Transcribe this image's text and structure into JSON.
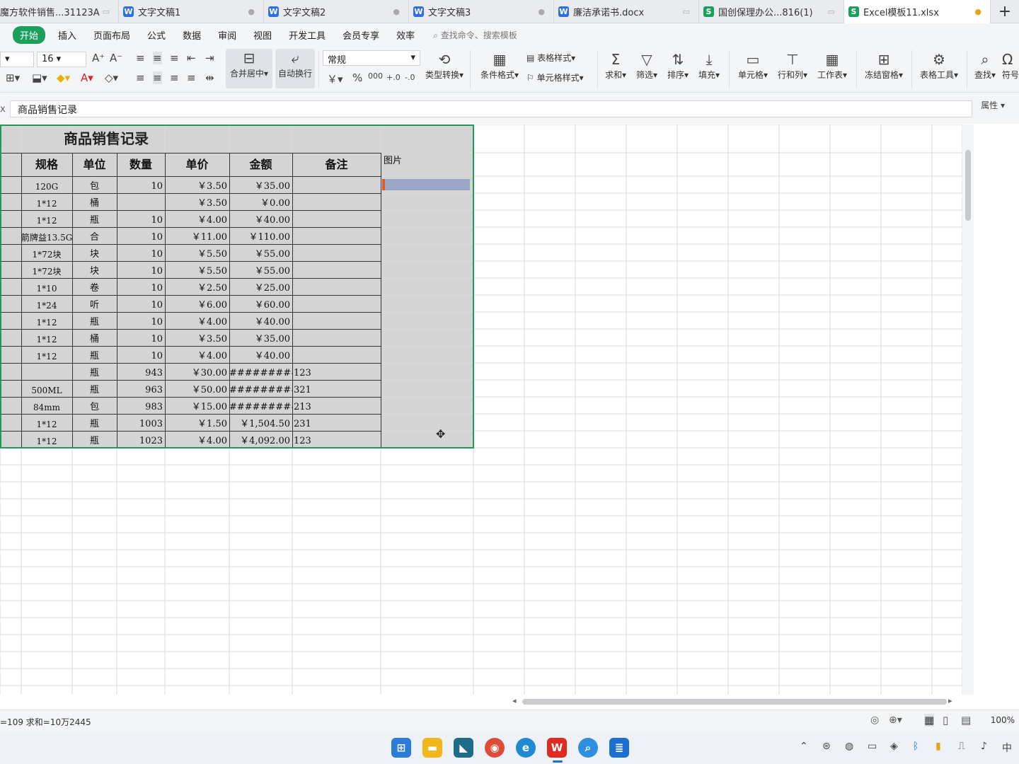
{
  "tabs": [
    {
      "label": "魔方软件销售...31123A",
      "icon": "W"
    },
    {
      "label": "文字文稿1",
      "icon": "W"
    },
    {
      "label": "文字文稿2",
      "icon": "W"
    },
    {
      "label": "文字文稿3",
      "icon": "W"
    },
    {
      "label": "廉洁承诺书.docx",
      "icon": "W"
    },
    {
      "label": "国创保理办公...816(1)",
      "icon": "S"
    },
    {
      "label": "Excel模板11.xlsx",
      "icon": "S"
    }
  ],
  "menu": [
    "开始",
    "插入",
    "页面布局",
    "公式",
    "数据",
    "审阅",
    "视图",
    "开发工具",
    "会员专享",
    "效率"
  ],
  "search_placeholder": "查找命令、搜索模板",
  "ribbon": {
    "font_size": "16",
    "number_format": "常规",
    "merge_label": "合并居中",
    "wrap_label": "自动换行",
    "type_convert": "类型转换",
    "cond_format": "条件格式",
    "table_style": "表格样式",
    "cell_style": "单元格样式",
    "sum": "求和",
    "filter": "筛选",
    "sort": "排序",
    "fill": "填充",
    "cell": "单元格",
    "rowcol": "行和列",
    "worksheet": "工作表",
    "freeze": "冻结窗格",
    "table_tools": "表格工具",
    "find": "查找",
    "symbol": "符号"
  },
  "formula_bar": {
    "value": "商品销售记录",
    "properties": "属性"
  },
  "sheet": {
    "title": "商品销售记录",
    "headers": [
      "规格",
      "单位",
      "数量",
      "单价",
      "金额",
      "备注",
      "图片"
    ],
    "rows": [
      [
        "120G",
        "包",
        "10",
        "￥3.50",
        "￥35.00",
        ""
      ],
      [
        "1*12",
        "桶",
        "",
        "￥3.50",
        "￥0.00",
        ""
      ],
      [
        "1*12",
        "瓶",
        "10",
        "￥4.00",
        "￥40.00",
        ""
      ],
      [
        "箭牌益13.5G",
        "合",
        "10",
        "￥11.00",
        "￥110.00",
        ""
      ],
      [
        "1*72块",
        "块",
        "10",
        "￥5.50",
        "￥55.00",
        ""
      ],
      [
        "1*72块",
        "块",
        "10",
        "￥5.50",
        "￥55.00",
        ""
      ],
      [
        "1*10",
        "卷",
        "10",
        "￥2.50",
        "￥25.00",
        ""
      ],
      [
        "1*24",
        "听",
        "10",
        "￥6.00",
        "￥60.00",
        ""
      ],
      [
        "1*12",
        "瓶",
        "10",
        "￥4.00",
        "￥40.00",
        ""
      ],
      [
        "1*12",
        "桶",
        "10",
        "￥3.50",
        "￥35.00",
        ""
      ],
      [
        "1*12",
        "瓶",
        "10",
        "￥4.00",
        "￥40.00",
        ""
      ],
      [
        "",
        "瓶",
        "943",
        "￥30.00",
        "##########",
        "123"
      ],
      [
        "500ML",
        "瓶",
        "963",
        "￥50.00",
        "##########",
        "321"
      ],
      [
        "84mm",
        "包",
        "983",
        "￥15.00",
        "##########",
        "213"
      ],
      [
        "1*12",
        "瓶",
        "1003",
        "￥1.50",
        "￥1,504.50",
        "231"
      ],
      [
        "1*12",
        "瓶",
        "1023",
        "￥4.00",
        "￥4,092.00",
        "123"
      ]
    ]
  },
  "status": {
    "text": "=109  求和=10万2445",
    "zoom": "100%"
  }
}
